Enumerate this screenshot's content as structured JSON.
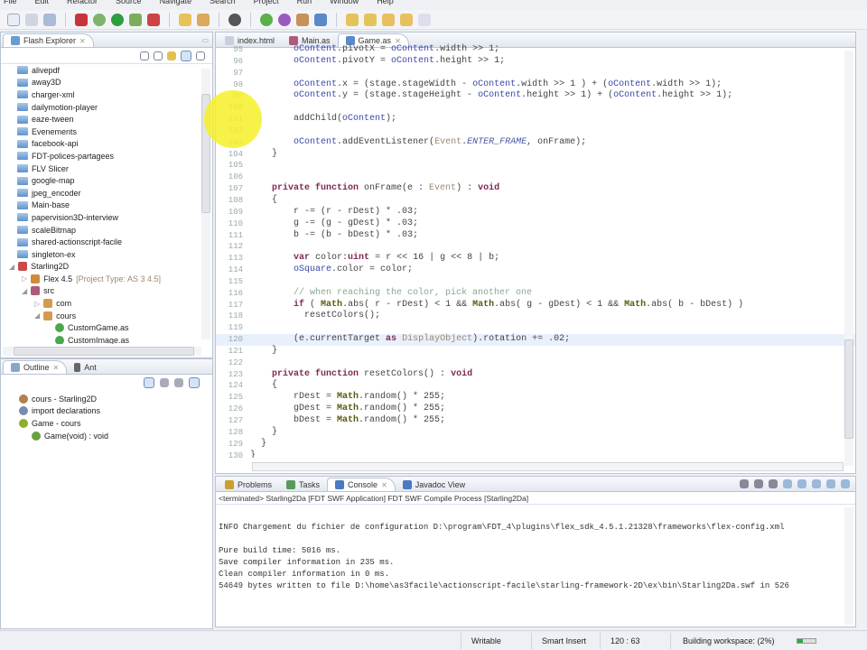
{
  "menu": [
    "File",
    "Edit",
    "Refactor",
    "Source",
    "Navigate",
    "Search",
    "Project",
    "Run",
    "Window",
    "Help"
  ],
  "explorer": {
    "title": "Flash Explorer",
    "items": [
      {
        "label": "alivepdf",
        "type": "folder",
        "level": 0
      },
      {
        "label": "away3D",
        "type": "folder",
        "level": 0
      },
      {
        "label": "charger-xml",
        "type": "folder",
        "level": 0
      },
      {
        "label": "dailymotion-player",
        "type": "folder",
        "level": 0
      },
      {
        "label": "eaze-tween",
        "type": "folder",
        "level": 0
      },
      {
        "label": "Evenements",
        "type": "folder",
        "level": 0
      },
      {
        "label": "facebook-api",
        "type": "folder",
        "level": 0
      },
      {
        "label": "FDT-polices-partagees",
        "type": "folder",
        "level": 0
      },
      {
        "label": "FLV Slicer",
        "type": "folder",
        "level": 0
      },
      {
        "label": "google-map",
        "type": "folder",
        "level": 0
      },
      {
        "label": "jpeg_encoder",
        "type": "folder",
        "level": 0
      },
      {
        "label": "Main-base",
        "type": "folder",
        "level": 0
      },
      {
        "label": "papervision3D-interview",
        "type": "folder",
        "level": 0
      },
      {
        "label": "scaleBitmap",
        "type": "folder",
        "level": 0
      },
      {
        "label": "shared-actionscript-facile",
        "type": "folder",
        "level": 0
      },
      {
        "label": "singleton-ex",
        "type": "folder",
        "level": 0
      },
      {
        "label": "Starling2D",
        "type": "project",
        "level": 0,
        "expanded": true
      },
      {
        "label": "Flex 4.5",
        "suffix": "[Project Type: AS 3 4.5]",
        "type": "sdk",
        "level": 1
      },
      {
        "label": "src",
        "type": "src",
        "level": 1,
        "expanded": true
      },
      {
        "label": "com",
        "type": "package",
        "level": 2
      },
      {
        "label": "cours",
        "type": "package",
        "level": 2,
        "expanded": true
      },
      {
        "label": "CustomGame.as",
        "type": "file",
        "level": 3
      },
      {
        "label": "CustomImage.as",
        "type": "file",
        "level": 3
      }
    ]
  },
  "outline": {
    "tabs": [
      "Outline",
      "Ant"
    ],
    "items": [
      {
        "label": "cours - Starling2D",
        "level": 0
      },
      {
        "label": "import declarations",
        "level": 0
      },
      {
        "label": "Game - cours",
        "level": 0
      },
      {
        "label": "Game(void) : void",
        "level": 1
      }
    ]
  },
  "editor": {
    "tabs": [
      {
        "label": "index.html"
      },
      {
        "label": "Main.as"
      },
      {
        "label": "Game.as",
        "active": true
      }
    ],
    "current_line": 120,
    "lines": [
      {
        "n": "95",
        "s": [
          [
            "",
            "        "
          ],
          [
            "obj",
            "oContent"
          ],
          [
            "",
            ".pivotX = "
          ],
          [
            "obj",
            "oContent"
          ],
          [
            "",
            ".width >> 1;"
          ]
        ]
      },
      {
        "n": "96",
        "s": [
          [
            "",
            "        "
          ],
          [
            "obj",
            "oContent"
          ],
          [
            "",
            ".pivotY = "
          ],
          [
            "obj",
            "oContent"
          ],
          [
            "",
            ".height >> 1;"
          ]
        ]
      },
      {
        "n": "97",
        "s": []
      },
      {
        "n": "98",
        "s": [
          [
            "",
            "        "
          ],
          [
            "obj",
            "oContent"
          ],
          [
            "",
            ".x = (stage.stageWidth - "
          ],
          [
            "obj",
            "oContent"
          ],
          [
            "",
            ".width >> 1 ) + ("
          ],
          [
            "obj",
            "oContent"
          ],
          [
            "",
            ".width >> 1);"
          ]
        ]
      },
      {
        "n": "99",
        "s": [
          [
            "",
            "        "
          ],
          [
            "obj",
            "oContent"
          ],
          [
            "",
            ".y = (stage.stageHeight - "
          ],
          [
            "obj",
            "oContent"
          ],
          [
            "",
            ".height >> 1) + ("
          ],
          [
            "obj",
            "oContent"
          ],
          [
            "",
            ".height >> 1);"
          ]
        ]
      },
      {
        "n": "100",
        "s": []
      },
      {
        "n": "101",
        "s": [
          [
            "",
            "        addChild("
          ],
          [
            "obj",
            "oContent"
          ],
          [
            "",
            ");"
          ]
        ]
      },
      {
        "n": "102",
        "s": []
      },
      {
        "n": "103",
        "s": [
          [
            "",
            "        "
          ],
          [
            "obj",
            "oContent"
          ],
          [
            "",
            ".addEventListener("
          ],
          [
            "ty",
            "Event"
          ],
          [
            "",
            "."
          ],
          [
            "cst",
            "ENTER_FRAME"
          ],
          [
            "",
            ", onFrame);"
          ]
        ]
      },
      {
        "n": "104",
        "s": [
          [
            "",
            "    }"
          ]
        ]
      },
      {
        "n": "105",
        "s": []
      },
      {
        "n": "106",
        "s": []
      },
      {
        "n": "107",
        "s": [
          [
            "",
            "    "
          ],
          [
            "kw",
            "private function"
          ],
          [
            "",
            " onFrame(e : "
          ],
          [
            "ty",
            "Event"
          ],
          [
            "",
            ") : "
          ],
          [
            "kw",
            "void"
          ]
        ]
      },
      {
        "n": "108",
        "s": [
          [
            "",
            "    {"
          ]
        ]
      },
      {
        "n": "109",
        "s": [
          [
            "",
            "        r -= (r - rDest) * .03;"
          ]
        ]
      },
      {
        "n": "110",
        "s": [
          [
            "",
            "        g -= (g - gDest) * .03;"
          ]
        ]
      },
      {
        "n": "111",
        "s": [
          [
            "",
            "        b -= (b - bDest) * .03;"
          ]
        ]
      },
      {
        "n": "112",
        "s": []
      },
      {
        "n": "113",
        "s": [
          [
            "",
            "        "
          ],
          [
            "kw",
            "var"
          ],
          [
            "",
            " color:"
          ],
          [
            "kw",
            "uint"
          ],
          [
            "",
            " = r << 16 | g << 8 | b;"
          ]
        ]
      },
      {
        "n": "114",
        "s": [
          [
            "",
            "        "
          ],
          [
            "obj",
            "oSquare"
          ],
          [
            "",
            ".color = color;"
          ]
        ]
      },
      {
        "n": "115",
        "s": []
      },
      {
        "n": "116",
        "s": [
          [
            "",
            "        "
          ],
          [
            "cm",
            "// when reaching the color, pick another one"
          ]
        ]
      },
      {
        "n": "117",
        "s": [
          [
            "",
            "        "
          ],
          [
            "kw",
            "if"
          ],
          [
            "",
            " ( "
          ],
          [
            "math",
            "Math"
          ],
          [
            "",
            ".abs( r - rDest) < 1 && "
          ],
          [
            "math",
            "Math"
          ],
          [
            "",
            ".abs( g - gDest) < 1 && "
          ],
          [
            "math",
            "Math"
          ],
          [
            "",
            ".abs( b - bDest) )"
          ]
        ]
      },
      {
        "n": "118",
        "s": [
          [
            "",
            "          resetColors();"
          ]
        ]
      },
      {
        "n": "119",
        "s": []
      },
      {
        "n": "120",
        "s": [
          [
            "",
            "        (e.currentTarget "
          ],
          [
            "kw",
            "as"
          ],
          [
            "",
            " "
          ],
          [
            "ty",
            "DisplayObject"
          ],
          [
            "",
            ").rotation += .02;"
          ]
        ]
      },
      {
        "n": "121",
        "s": [
          [
            "",
            "    }"
          ]
        ]
      },
      {
        "n": "122",
        "s": []
      },
      {
        "n": "123",
        "s": [
          [
            "",
            "    "
          ],
          [
            "kw",
            "private function"
          ],
          [
            "",
            " resetColors() : "
          ],
          [
            "kw",
            "void"
          ]
        ]
      },
      {
        "n": "124",
        "s": [
          [
            "",
            "    {"
          ]
        ]
      },
      {
        "n": "125",
        "s": [
          [
            "",
            "        rDest = "
          ],
          [
            "math",
            "Math"
          ],
          [
            "",
            ".random() * 255;"
          ]
        ]
      },
      {
        "n": "126",
        "s": [
          [
            "",
            "        gDest = "
          ],
          [
            "math",
            "Math"
          ],
          [
            "",
            ".random() * 255;"
          ]
        ]
      },
      {
        "n": "127",
        "s": [
          [
            "",
            "        bDest = "
          ],
          [
            "math",
            "Math"
          ],
          [
            "",
            ".random() * 255;"
          ]
        ]
      },
      {
        "n": "128",
        "s": [
          [
            "",
            "    }"
          ]
        ]
      },
      {
        "n": "129",
        "s": [
          [
            "",
            "  }"
          ]
        ]
      },
      {
        "n": "130",
        "s": [
          [
            "",
            "}"
          ]
        ]
      }
    ]
  },
  "console": {
    "tabs": [
      {
        "label": "Problems"
      },
      {
        "label": "Tasks"
      },
      {
        "label": "Console",
        "active": true
      },
      {
        "label": "Javadoc View"
      }
    ],
    "header": "<terminated> Starling2Da [FDT SWF Application] FDT SWF Compile Process [Starling2Da]",
    "lines": [
      "",
      "INFO Chargement du fichier de configuration D:\\program\\FDT_4\\plugins\\flex_sdk_4.5.1.21328\\frameworks\\flex-config.xml",
      "",
      "Pure build time: 5016 ms.",
      "Save compiler information in 235 ms.",
      "Clean compiler information in 0 ms.",
      "54649 bytes written to file D:\\home\\as3facile\\actionscript-facile\\starling-framework-2D\\ex\\bin\\Starling2Da.swf in 526"
    ]
  },
  "status": {
    "writable": "Writable",
    "insert_mode": "Smart Insert",
    "position": "120 : 63",
    "progress_label": "Building workspace: (2%)",
    "progress_fraction": 0.02
  },
  "colors": {
    "highlight": "#f6f04a",
    "current_line": "#e8f0fb"
  }
}
